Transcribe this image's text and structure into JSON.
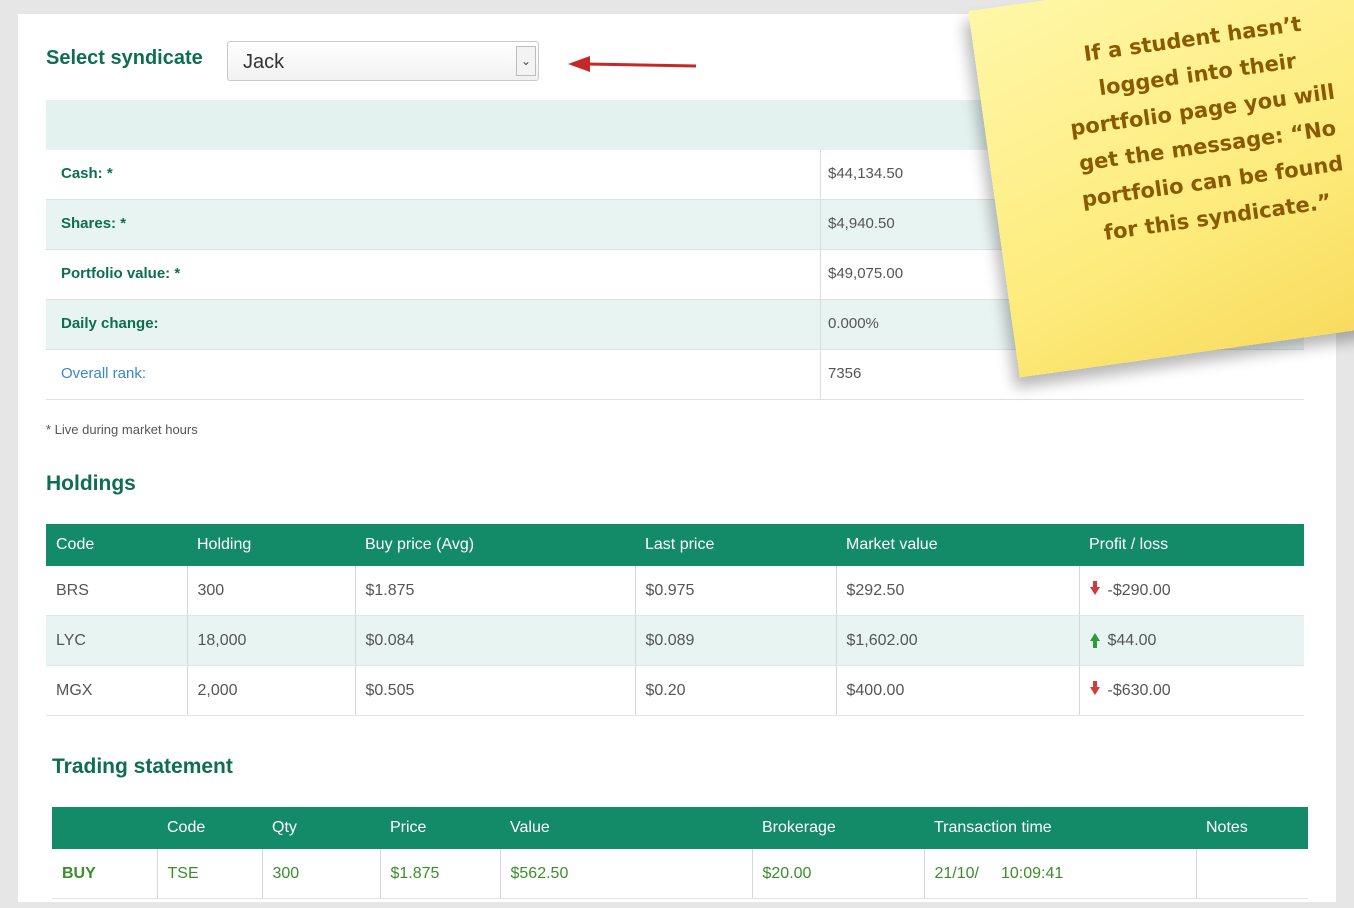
{
  "syndicate": {
    "label": "Select syndicate",
    "selected": "Jack"
  },
  "summary": [
    {
      "label": "Cash: *",
      "value": "$44,134.50",
      "alt": false,
      "link": false
    },
    {
      "label": "Shares: *",
      "value": "$4,940.50",
      "alt": true,
      "link": false
    },
    {
      "label": "Portfolio value: *",
      "value": "$49,075.00",
      "alt": false,
      "link": false
    },
    {
      "label": "Daily change:",
      "value": "0.000%",
      "alt": true,
      "link": false
    },
    {
      "label": "Overall rank:",
      "value": "7356",
      "alt": false,
      "link": true
    }
  ],
  "footnote": "* Live during market hours",
  "holdings": {
    "title": "Holdings",
    "columns": [
      "Code",
      "Holding",
      "Buy price (Avg)",
      "Last price",
      "Market value",
      "Profit / loss"
    ],
    "rows": [
      {
        "code": "BRS",
        "holding": "300",
        "buy": "$1.875",
        "last": "$0.975",
        "market": "$292.50",
        "pl": "-$290.00",
        "dir": "down"
      },
      {
        "code": "LYC",
        "holding": "18,000",
        "buy": "$0.084",
        "last": "$0.089",
        "market": "$1,602.00",
        "pl": "$44.00",
        "dir": "up"
      },
      {
        "code": "MGX",
        "holding": "2,000",
        "buy": "$0.505",
        "last": "$0.20",
        "market": "$400.00",
        "pl": "-$630.00",
        "dir": "down"
      }
    ]
  },
  "trading": {
    "title": "Trading statement",
    "columns": [
      "",
      "Code",
      "Qty",
      "Price",
      "Value",
      "Brokerage",
      "Transaction time",
      "Notes"
    ],
    "rows": [
      {
        "type": "BUY",
        "code": "TSE",
        "qty": "300",
        "price": "$1.875",
        "value": "$562.50",
        "brokerage": "$20.00",
        "date": "21/10/",
        "time": "10:09:41",
        "notes": ""
      }
    ]
  },
  "sticky_note": {
    "lines": [
      "If a student hasn’t",
      "logged into their",
      "portfolio page you will",
      "get the message: “No",
      "portfolio can be found",
      "for this syndicate.”"
    ]
  },
  "colors": {
    "brand_green": "#138a68",
    "heading_green": "#0d6e52",
    "loss_red": "#d23b3b",
    "gain_green": "#2f9a3a",
    "note_yellow": "#fdeb7b"
  }
}
